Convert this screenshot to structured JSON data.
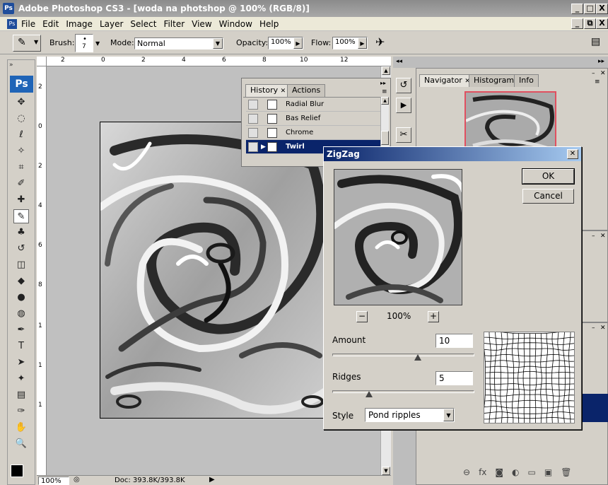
{
  "app": {
    "title": "Adobe Photoshop CS3 - [woda na photshop @ 100% (RGB/8)]",
    "logo": "Ps",
    "title_buttons": [
      "_",
      "□",
      "X"
    ],
    "doc_buttons": [
      "_",
      "⧉",
      "X"
    ]
  },
  "menu": [
    "File",
    "Edit",
    "Image",
    "Layer",
    "Select",
    "Filter",
    "View",
    "Window",
    "Help"
  ],
  "options": {
    "brush_label": "Brush:",
    "brush_size": "7",
    "mode_label": "Mode:",
    "mode_value": "Normal",
    "opacity_label": "Opacity:",
    "opacity_value": "100%",
    "flow_label": "Flow:",
    "flow_value": "100%"
  },
  "rulers": {
    "h_ticks": [
      "2",
      "0",
      "2",
      "4",
      "6",
      "8",
      "10",
      "12"
    ],
    "v_ticks": [
      "2",
      "0",
      "2",
      "4",
      "6",
      "8",
      "1",
      "1",
      "1"
    ]
  },
  "status": {
    "zoom": "100%",
    "doc": "Doc: 393.8K/393.8K"
  },
  "history": {
    "tabs": [
      "History",
      "Actions"
    ],
    "items": [
      {
        "label": "Radial Blur",
        "selected": false
      },
      {
        "label": "Bas Relief",
        "selected": false
      },
      {
        "label": "Chrome",
        "selected": false
      },
      {
        "label": "Twirl",
        "selected": true
      }
    ]
  },
  "navigator": {
    "tabs": [
      "Navigator",
      "Histogram",
      "Info"
    ]
  },
  "dialog": {
    "title": "ZigZag",
    "ok": "OK",
    "cancel": "Cancel",
    "zoom": "100%",
    "minus": "−",
    "plus": "+",
    "amount_label": "Amount",
    "amount_value": "10",
    "amount_fraction": 0.6,
    "ridges_label": "Ridges",
    "ridges_value": "5",
    "ridges_fraction": 0.26,
    "style_label": "Style",
    "style_value": "Pond ripples"
  },
  "icons": {
    "tools": [
      "move-icon",
      "marquee-icon",
      "lasso-icon",
      "magic-wand-icon",
      "crop-icon",
      "slice-icon",
      "healing-icon",
      "brush-icon",
      "clone-stamp-icon",
      "history-brush-icon",
      "eraser-icon",
      "bucket-icon",
      "blur-icon",
      "dodge-icon",
      "pen-icon",
      "type-icon",
      "path-select-icon",
      "shape-icon",
      "notes-icon",
      "eyedropper-icon",
      "hand-icon",
      "zoom-icon"
    ]
  }
}
